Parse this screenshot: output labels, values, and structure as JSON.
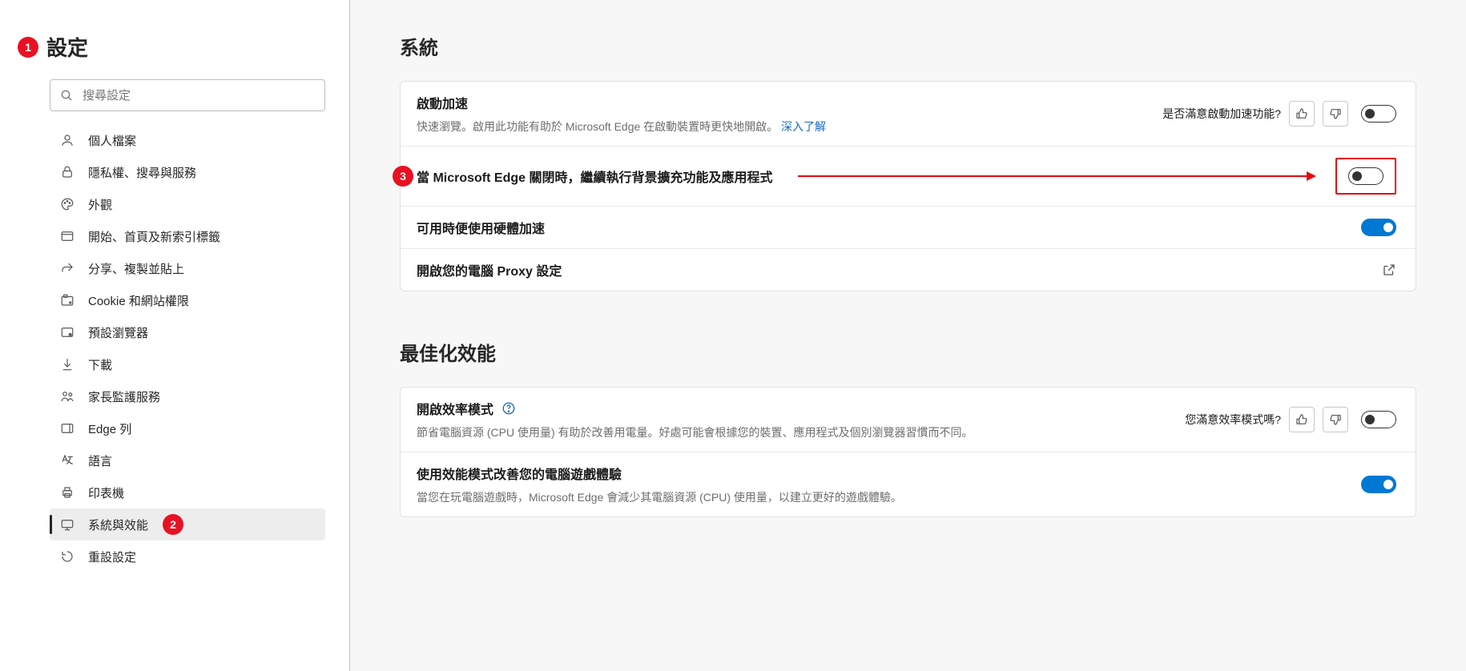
{
  "sidebar": {
    "title": "設定",
    "badge": "1",
    "search_placeholder": "搜尋設定",
    "items": [
      {
        "label": "個人檔案",
        "icon": "profile-icon"
      },
      {
        "label": "隱私權、搜尋與服務",
        "icon": "lock-icon"
      },
      {
        "label": "外觀",
        "icon": "palette-icon"
      },
      {
        "label": "開始、首頁及新索引標籤",
        "icon": "tab-icon"
      },
      {
        "label": "分享、複製並貼上",
        "icon": "share-icon"
      },
      {
        "label": "Cookie 和網站權限",
        "icon": "cookie-icon"
      },
      {
        "label": "預設瀏覽器",
        "icon": "browser-icon"
      },
      {
        "label": "下載",
        "icon": "download-icon"
      },
      {
        "label": "家長監護服務",
        "icon": "family-icon"
      },
      {
        "label": "Edge 列",
        "icon": "edgebar-icon"
      },
      {
        "label": "語言",
        "icon": "language-icon"
      },
      {
        "label": "印表機",
        "icon": "printer-icon"
      },
      {
        "label": "系統與效能",
        "icon": "system-icon",
        "active": true,
        "badge": "2"
      },
      {
        "label": "重設設定",
        "icon": "reset-icon"
      }
    ]
  },
  "main": {
    "sections": [
      {
        "title": "系統",
        "rows": [
          {
            "title": "啟動加速",
            "desc_prefix": "快速瀏覽。啟用此功能有助於 Microsoft Edge 在啟動裝置時更快地開啟。",
            "link_text": "深入了解",
            "feedback_q": "是否滿意啟動加速功能?",
            "toggle": "off"
          },
          {
            "title": "當 Microsoft Edge 關閉時，繼續執行背景擴充功能及應用程式",
            "callout_badge": "3",
            "toggle": "off",
            "highlight": true
          },
          {
            "title": "可用時便使用硬體加速",
            "toggle": "on"
          },
          {
            "title": "開啟您的電腦 Proxy 設定",
            "open_external": true
          }
        ]
      },
      {
        "title": "最佳化效能",
        "rows": [
          {
            "title": "開啟效率模式",
            "help_icon": true,
            "desc_prefix": "節省電腦資源 (CPU 使用量) 有助於改善用電量。好處可能會根據您的裝置、應用程式及個別瀏覽器習慣而不同。",
            "feedback_q": "您滿意效率模式嗎?",
            "toggle": "off"
          },
          {
            "title": "使用效能模式改善您的電腦遊戲體驗",
            "desc_prefix": "當您在玩電腦遊戲時，Microsoft Edge 會減少其電腦資源 (CPU) 使用量，以建立更好的遊戲體驗。",
            "toggle": "on"
          }
        ]
      }
    ]
  }
}
